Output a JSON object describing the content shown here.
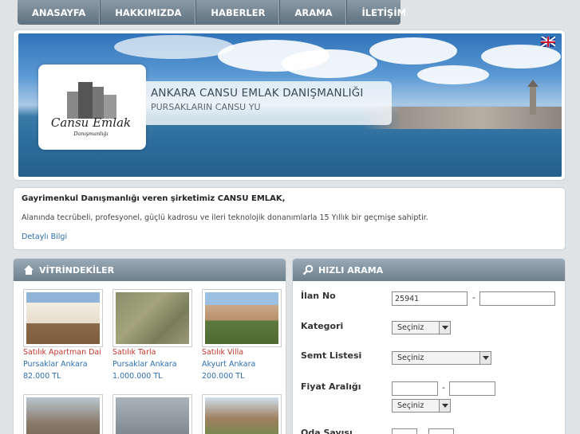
{
  "nav": {
    "items": [
      "ANASAYFA",
      "HAKKIMIZDA",
      "HABERLER",
      "ARAMA",
      "İLETİŞİM"
    ]
  },
  "banner": {
    "logo_text": "Cansu Emlak",
    "logo_sub": "Danışmanlığı",
    "title": "ANKARA CANSU EMLAK DANIŞMANLIĞI",
    "subtitle": "PURSAKLARIN CANSU YU",
    "flag_icon": "uk-flag-icon"
  },
  "intro": {
    "heading": "Gayrimenkul Danışmanlığı veren şirketimiz CANSU EMLAK,",
    "text": "Alanında tecrübeli, profesyonel, güçlü kadrosu ve ileri teknolojik donanımlarla 15 Yıllık bir geçmişe sahiptir.",
    "link": "Detaylı Bilgi"
  },
  "vitrin": {
    "title": "VİTRİNDEKİLER",
    "icon": "home-icon",
    "listings": [
      {
        "title": "Satılık Apartman Dai",
        "location": "Pursaklar Ankara",
        "price": "82.000 TL"
      },
      {
        "title": "Satılık Tarla",
        "location": "Pursaklar Ankara",
        "price": "1.000.000 TL"
      },
      {
        "title": "Satılık Villa",
        "location": "Akyurt Ankara",
        "price": "200.000 TL"
      }
    ]
  },
  "hizli": {
    "title": "HIZLI ARAMA",
    "icon": "search-icon",
    "ilan_label": "İlan No",
    "ilan_value": "25941",
    "ilan_sep": "-",
    "kategori_label": "Kategori",
    "kategori_value": "Seçiniz",
    "semt_label": "Semt Listesi",
    "semt_value": "Seçiniz",
    "fiyat_label": "Fiyat Aralığı",
    "fiyat_sep": "-",
    "fiyat_currency": "Seçiniz",
    "oda_label": "Oda Sayısı"
  },
  "colors": {
    "nav_bg": "#6f808c",
    "link_blue": "#2c6fb0",
    "listing_red": "#c0392b"
  }
}
